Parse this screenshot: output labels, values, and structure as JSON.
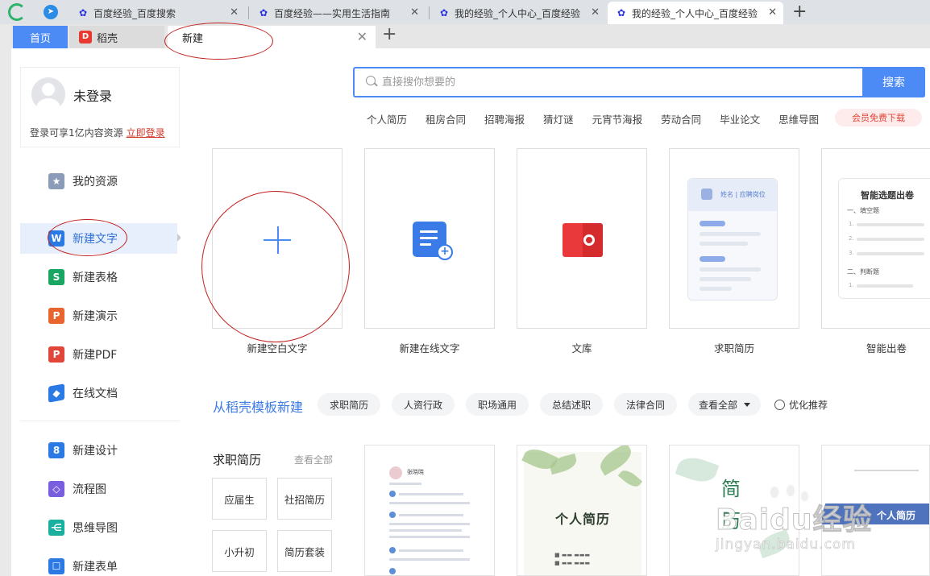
{
  "browser": {
    "tabs": [
      {
        "title": "百度经验_百度搜索"
      },
      {
        "title": "百度经验——实用生活指南"
      },
      {
        "title": "我的经验_个人中心_百度经验"
      },
      {
        "title": "我的经验_个人中心_百度经验"
      }
    ]
  },
  "app_tabs": {
    "home": "首页",
    "docer": "稻壳",
    "new": "新建"
  },
  "user": {
    "name": "未登录",
    "hint": "登录可享1亿内容资源",
    "login_link": "立即登录"
  },
  "sidebar": {
    "items": [
      {
        "label": "我的资源",
        "icon": "star-icon",
        "color": "#8b9bb8"
      },
      {
        "label": "新建文字",
        "icon": "writer-icon",
        "color": "#2b79e4"
      },
      {
        "label": "新建表格",
        "icon": "spreadsheet-icon",
        "color": "#19a562"
      },
      {
        "label": "新建演示",
        "icon": "presentation-icon",
        "color": "#e8652f"
      },
      {
        "label": "新建PDF",
        "icon": "pdf-icon",
        "color": "#e2463a"
      },
      {
        "label": "在线文档",
        "icon": "cloud-doc-icon",
        "color": "#2b79e4"
      },
      {
        "label": "新建设计",
        "icon": "design-icon",
        "color": "#2b79e4"
      },
      {
        "label": "流程图",
        "icon": "flowchart-icon",
        "color": "#7a5ee0"
      },
      {
        "label": "思维导图",
        "icon": "mindmap-icon",
        "color": "#19b0a0"
      },
      {
        "label": "新建表单",
        "icon": "form-icon",
        "color": "#2b79e4"
      }
    ]
  },
  "search": {
    "placeholder": "直接搜你想要的",
    "button": "搜索",
    "hot_links": [
      "个人简历",
      "租房合同",
      "招聘海报",
      "猜灯谜",
      "元宵节海报",
      "劳动合同",
      "毕业论文",
      "思维导图"
    ],
    "vip_badge": "会员免费下载"
  },
  "cards": [
    {
      "label": "新建空白文字"
    },
    {
      "label": "新建在线文字"
    },
    {
      "label": "文库"
    },
    {
      "label": "求职简历",
      "thumb_text": "姓名 | 应聘岗位"
    },
    {
      "label": "智能出卷",
      "thumb_title": "智能选题出卷",
      "thumb_q1": "一、填空题",
      "thumb_q2": "二、判断题"
    }
  ],
  "templates": {
    "title": "从稻壳模板新建",
    "pills": [
      "求职简历",
      "人资行政",
      "职场通用",
      "总结述职",
      "法律合同",
      "查看全部",
      "优化推荐"
    ]
  },
  "resume_section": {
    "title": "求职简历",
    "more": "查看全部",
    "categories": [
      "应届生",
      "社招简历",
      "小升初",
      "简历套装"
    ],
    "thumbs": [
      {
        "name": "张晓晓"
      },
      {
        "title": "个人简历"
      },
      {
        "title": "简",
        "title2": "历"
      },
      {
        "title": "个人简历"
      }
    ]
  },
  "watermark": {
    "text": "Baidu经验",
    "url": "jingyan.baidu.com"
  }
}
